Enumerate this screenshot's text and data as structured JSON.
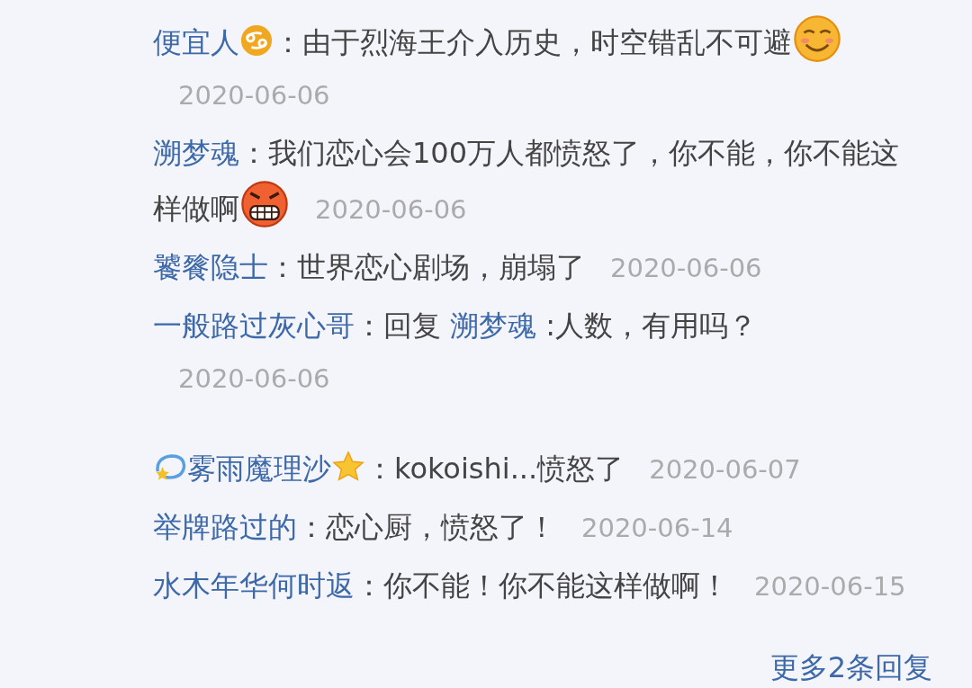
{
  "comments": [
    {
      "name_parts": [
        {
          "kind": "name",
          "text": "便宜人"
        },
        {
          "kind": "zodiac-icon"
        }
      ],
      "parts": [
        {
          "kind": "text",
          "text": "：由于烈海王介入历史，时空错乱不可避"
        },
        {
          "kind": "smile-emoji"
        }
      ],
      "date": "2020-06-06"
    },
    {
      "name_parts": [
        {
          "kind": "name",
          "text": "溯梦魂"
        }
      ],
      "parts": [
        {
          "kind": "text",
          "text": "：我们恋心会100万人都愤怒了，你不能，你不能这样做啊"
        },
        {
          "kind": "angry-emoji"
        }
      ],
      "date": "2020-06-06"
    },
    {
      "name_parts": [
        {
          "kind": "name",
          "text": "饕餮隐士"
        }
      ],
      "parts": [
        {
          "kind": "text",
          "text": "：世界恋心剧场，崩塌了"
        }
      ],
      "date": "2020-06-06"
    },
    {
      "name_parts": [
        {
          "kind": "name",
          "text": "一般路过灰心哥"
        }
      ],
      "parts": [
        {
          "kind": "text",
          "text": "：回复 "
        },
        {
          "kind": "reply",
          "text": "溯梦魂"
        },
        {
          "kind": "text",
          "text": " :人数，有用吗？"
        }
      ],
      "date": "2020-06-06"
    },
    {
      "name_parts": [
        {
          "kind": "comet-icon"
        },
        {
          "kind": "name",
          "text": "雾雨魔理沙"
        },
        {
          "kind": "star-icon"
        }
      ],
      "parts": [
        {
          "kind": "text",
          "text": "：kokoishi...愤怒了"
        }
      ],
      "date": "2020-06-07"
    },
    {
      "name_parts": [
        {
          "kind": "name",
          "text": "举牌路过的"
        }
      ],
      "parts": [
        {
          "kind": "text",
          "text": "：恋心厨，愤怒了！"
        }
      ],
      "date": "2020-06-14"
    },
    {
      "name_parts": [
        {
          "kind": "name",
          "text": "水木年华何时返"
        }
      ],
      "parts": [
        {
          "kind": "text",
          "text": "：你不能！你不能这样做啊！"
        }
      ],
      "date": "2020-06-15"
    }
  ],
  "more_replies": "更多2条回复"
}
